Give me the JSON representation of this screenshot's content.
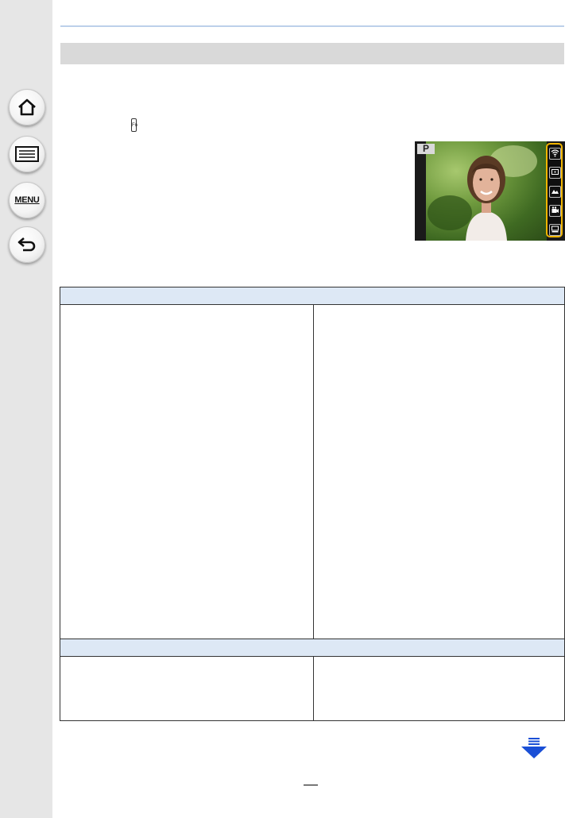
{
  "sidebar": {
    "home_icon": "home-icon",
    "contents_icon": "list-icon",
    "menu_label": "MENU",
    "back_icon": "back-arrow-icon"
  },
  "body_icons": {
    "fn_button": "fn-button-icon"
  },
  "camera_preview": {
    "mode_label": "P",
    "panel_highlight_color": "#f0b400",
    "touch_tab_icons": [
      "wifi-icon",
      "af-icon",
      "scene-icon",
      "movie-icon",
      "display-icon"
    ]
  },
  "colors": {
    "table_header_fill": "#dde8f5",
    "top_rule": "#bcd0ea",
    "section_bar": "#d9d9d9",
    "scroll_arrow": "#1a4fd6"
  },
  "navigation": {
    "next_page_icon": "next-page-arrow-icon"
  }
}
